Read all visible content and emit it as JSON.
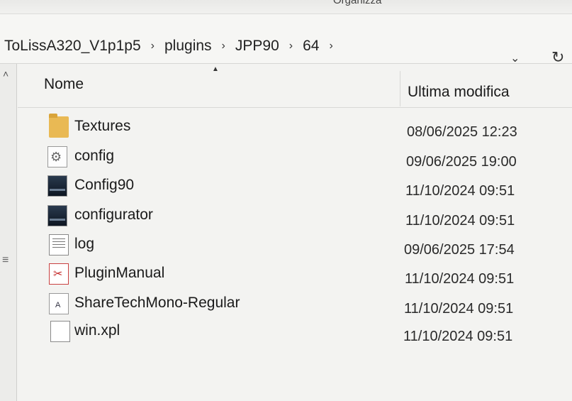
{
  "ribbon": {
    "title": "Organizza"
  },
  "breadcrumb": [
    "ToLissA320_V1p1p5",
    "plugins",
    "JPP90",
    "64"
  ],
  "breadcrumb_separator": "›",
  "columns": {
    "name": "Nome",
    "modified": "Ultima modifica"
  },
  "files": [
    {
      "name": "Textures",
      "date": "08/06/2025 12:23",
      "icon": "folder-icon"
    },
    {
      "name": "config",
      "date": "09/06/2025 19:00",
      "icon": "config-file-icon"
    },
    {
      "name": "Config90",
      "date": "11/10/2024 09:51",
      "icon": "image-file-icon"
    },
    {
      "name": "configurator",
      "date": "11/10/2024 09:51",
      "icon": "image-file-icon"
    },
    {
      "name": "log",
      "date": "09/06/2025 17:54",
      "icon": "text-file-icon"
    },
    {
      "name": "PluginManual",
      "date": "11/10/2024 09:51",
      "icon": "pdf-file-icon"
    },
    {
      "name": "ShareTechMono-Regular",
      "date": "11/10/2024 09:51",
      "icon": "font-file-icon"
    },
    {
      "name": "win.xpl",
      "date": "11/10/2024 09:51",
      "icon": "generic-file-icon"
    }
  ]
}
